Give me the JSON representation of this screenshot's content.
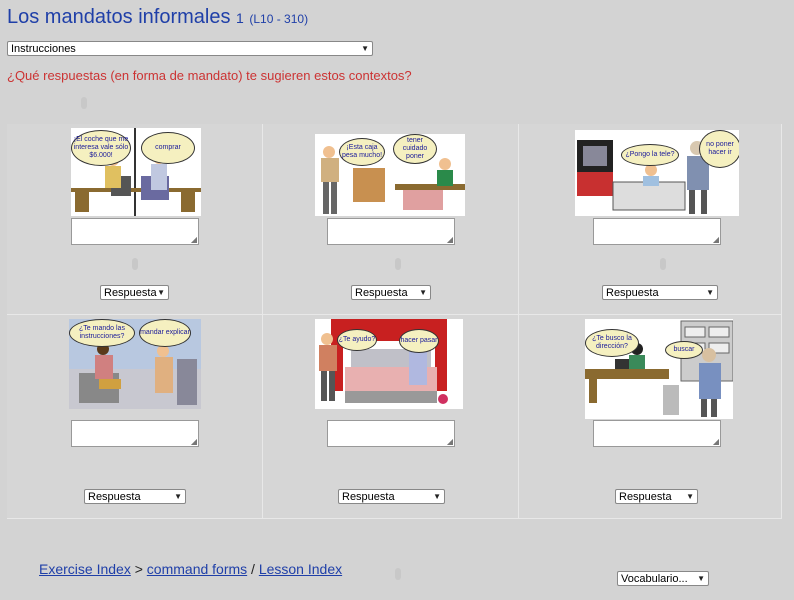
{
  "title": {
    "main": "Los mandatos informales",
    "number": "1",
    "ref": "(L10 - 310)"
  },
  "instructions_select": {
    "selected": "Instrucciones"
  },
  "question": "¿Qué respuestas (en forma de mandato) te sugieren estos contextos?",
  "scenes": [
    {
      "bubbles": [
        "¡El coche que me interesa vale sólo $6.000!",
        "comprar"
      ],
      "response_label": "Respuesta"
    },
    {
      "bubbles": [
        "¡Esta caja pesa mucho!",
        "tener cuidado poner"
      ],
      "response_label": "Respuesta"
    },
    {
      "bubbles": [
        "¿Pongo la tele?",
        "no poner hacer ir"
      ],
      "response_label": "Respuesta"
    },
    {
      "bubbles": [
        "¿Te mando las instrucciones?",
        "mandar explicar"
      ],
      "response_label": "Respuesta"
    },
    {
      "bubbles": [
        "¿Te ayudo?",
        "hacer pasar"
      ],
      "response_label": "Respuesta"
    },
    {
      "bubbles": [
        "¿Te busco la dirección?",
        "buscar"
      ],
      "response_label": "Respuesta"
    }
  ],
  "nav": {
    "exercise_index": "Exercise Index",
    "sep1": ">",
    "command_forms": "command forms",
    "sep2": "/",
    "lesson_index": "Lesson Index"
  },
  "vocab_select": {
    "selected": "Vocabulario..."
  },
  "colors": {
    "title": "#1f3fa8",
    "question": "#cc3333",
    "background": "#d3d3d3",
    "bubble_fill": "#f5f0c0",
    "bubble_text": "#1a1a9a"
  }
}
